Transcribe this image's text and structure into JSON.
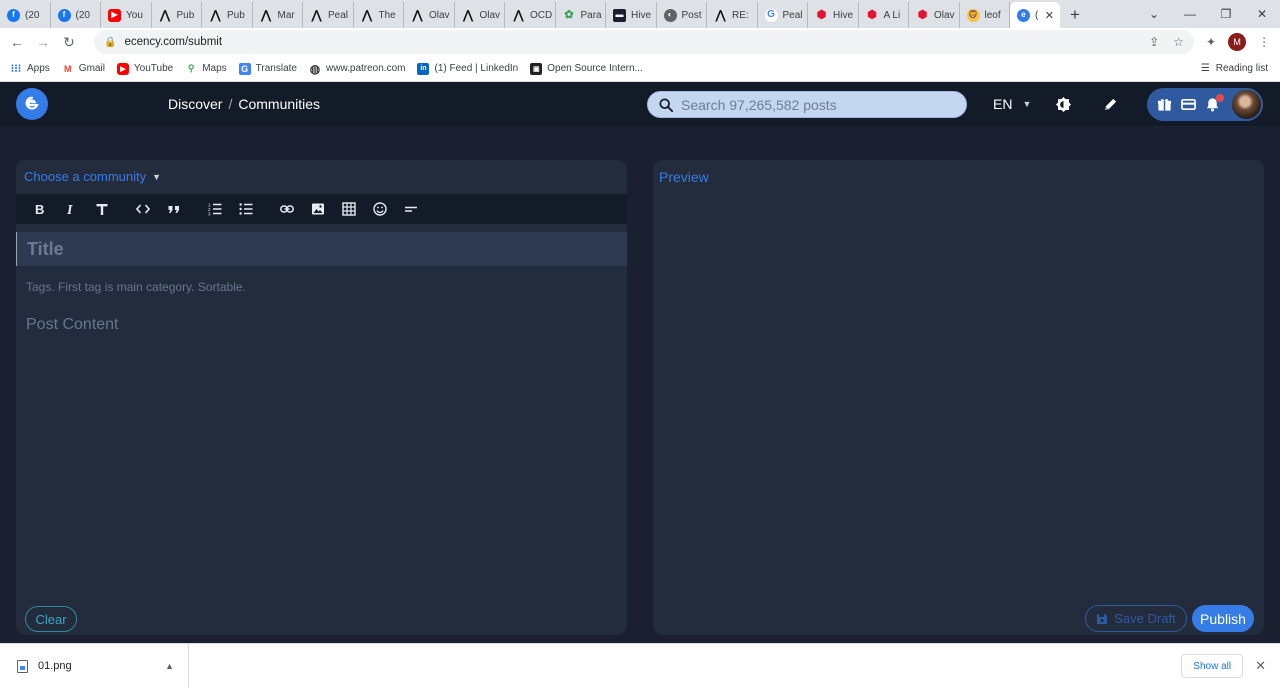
{
  "browser": {
    "tabs": [
      {
        "label": "(20",
        "icon": "facebook-icon",
        "fav": "fb",
        "glyph": "f"
      },
      {
        "label": "(20",
        "icon": "facebook-icon",
        "fav": "fb",
        "glyph": "f"
      },
      {
        "label": "You",
        "icon": "youtube-icon",
        "fav": "yt",
        "glyph": "▶"
      },
      {
        "label": "Pub",
        "icon": "peakd-icon",
        "fav": "peak",
        "glyph": "⋀"
      },
      {
        "label": "Pub",
        "icon": "peakd-icon",
        "fav": "peak",
        "glyph": "⋀"
      },
      {
        "label": "Mar",
        "icon": "peakd-icon",
        "fav": "peak",
        "glyph": "⋀"
      },
      {
        "label": "Peal",
        "icon": "peakd-icon",
        "fav": "peak",
        "glyph": "⋀"
      },
      {
        "label": "The",
        "icon": "peakd-icon",
        "fav": "peak",
        "glyph": "⋀"
      },
      {
        "label": "Olav",
        "icon": "peakd-icon",
        "fav": "peak",
        "glyph": "⋀"
      },
      {
        "label": "Olav",
        "icon": "peakd-icon",
        "fav": "peak",
        "glyph": "⋀"
      },
      {
        "label": "OCD",
        "icon": "peakd-icon",
        "fav": "peak",
        "glyph": "⋀"
      },
      {
        "label": "Para",
        "icon": "para-icon",
        "fav": "para",
        "glyph": "✿"
      },
      {
        "label": "Hive",
        "icon": "hive-square-icon",
        "fav": "hivesq",
        "glyph": "▬"
      },
      {
        "label": "Post",
        "icon": "globe-icon",
        "fav": "web",
        "glyph": "◐"
      },
      {
        "label": "RE:",
        "icon": "peakd-icon",
        "fav": "peak",
        "glyph": "⋀"
      },
      {
        "label": "Peal",
        "icon": "google-icon",
        "fav": "goog",
        "glyph": "G"
      },
      {
        "label": "Hive",
        "icon": "hive-icon",
        "fav": "hive",
        "glyph": "⬢"
      },
      {
        "label": "A Li",
        "icon": "hive-icon",
        "fav": "hive",
        "glyph": "⬢"
      },
      {
        "label": "Olav",
        "icon": "hive-icon",
        "fav": "hive",
        "glyph": "⬢"
      },
      {
        "label": "leof",
        "icon": "leofinance-icon",
        "fav": "leo",
        "glyph": "🦁"
      }
    ],
    "active_tab": {
      "label": "(",
      "icon": "ecency-icon"
    },
    "url": "ecency.com/submit",
    "bookmarks": [
      {
        "label": "Apps",
        "icon": "apps-grid-icon",
        "cls": "apps",
        "glyph": "⁝⁝⁝"
      },
      {
        "label": "Gmail",
        "icon": "gmail-icon",
        "cls": "gmail",
        "glyph": "M"
      },
      {
        "label": "YouTube",
        "icon": "youtube-icon",
        "cls": "yt",
        "glyph": "▶"
      },
      {
        "label": "Maps",
        "icon": "maps-icon",
        "cls": "maps",
        "glyph": "⚲"
      },
      {
        "label": "Translate",
        "icon": "translate-icon",
        "cls": "tr",
        "glyph": "G"
      },
      {
        "label": "www.patreon.com",
        "icon": "globe-icon",
        "cls": "pat",
        "glyph": "◍"
      },
      {
        "label": "(1) Feed | LinkedIn",
        "icon": "linkedin-icon",
        "cls": "li",
        "glyph": "in"
      },
      {
        "label": "Open Source Intern...",
        "icon": "opensource-icon",
        "cls": "os",
        "glyph": "▣"
      }
    ],
    "reading_list": "Reading list",
    "profile_initial": "M"
  },
  "app": {
    "breadcrumb": {
      "discover": "Discover",
      "separator": "/",
      "communities": "Communities"
    },
    "search_placeholder": "Search 97,265,582 posts",
    "language": "EN",
    "editor": {
      "community_label": "Choose a community",
      "title_placeholder": "Title",
      "tags_placeholder": "Tags. First tag is main category. Sortable.",
      "content_placeholder": "Post Content",
      "clear_label": "Clear"
    },
    "preview": {
      "title": "Preview",
      "save_draft_label": "Save Draft",
      "publish_label": "Publish"
    },
    "colors": {
      "accent": "#357ce6",
      "nav_bg": "#131a28",
      "panel_bg": "#232c3c",
      "page_bg": "#1a2030"
    }
  },
  "downloads": {
    "file_name": "01.png",
    "show_all_label": "Show all"
  }
}
